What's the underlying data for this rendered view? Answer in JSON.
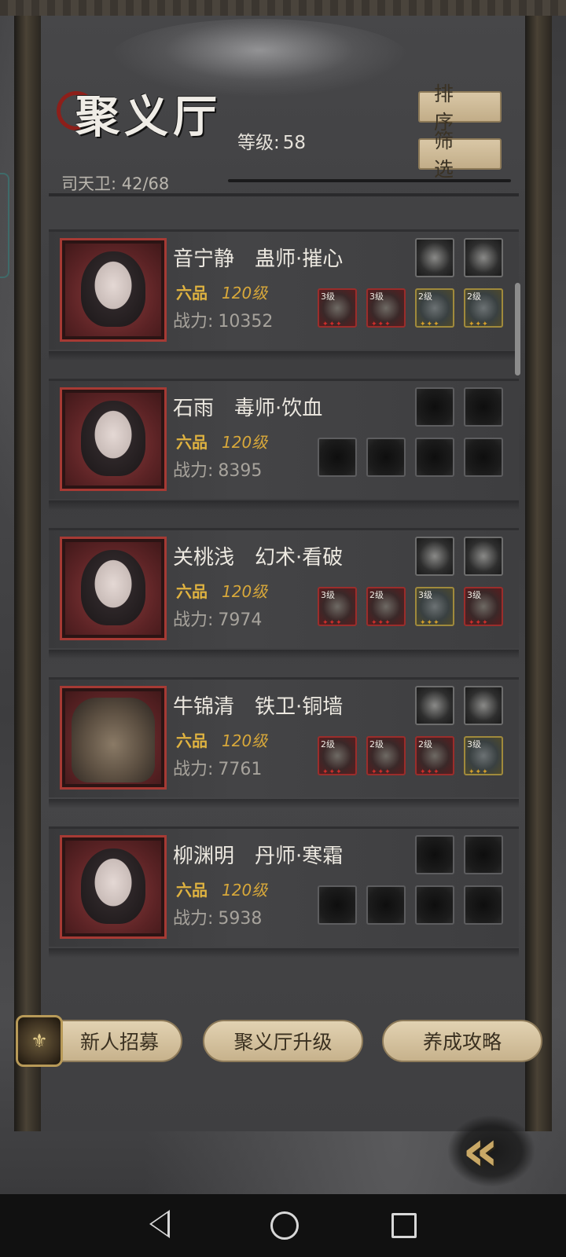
{
  "header": {
    "title": "聚义厅",
    "level_label": "等级:",
    "level_value": "58",
    "guard_count": "司天卫: 42/68",
    "sort_label": "排序",
    "filter_label": "筛选"
  },
  "heroes": [
    {
      "name": "音宁静　蛊师·摧心",
      "rank": "六品",
      "level": "120级",
      "power_label": "战力:",
      "power": "10352",
      "slots_top": [
        "",
        ""
      ],
      "slots_bottom": [
        "3级",
        "3级",
        "2级",
        "2级"
      ]
    },
    {
      "name": "石雨　毒师·饮血",
      "rank": "六品",
      "level": "120级",
      "power_label": "战力:",
      "power": "8395",
      "slots_top": [
        "",
        ""
      ],
      "slots_bottom": [
        "",
        "",
        "",
        ""
      ]
    },
    {
      "name": "关桃浅　幻术·看破",
      "rank": "六品",
      "level": "120级",
      "power_label": "战力:",
      "power": "7974",
      "slots_top": [
        "",
        ""
      ],
      "slots_bottom": [
        "3级",
        "2级",
        "3级",
        "3级"
      ]
    },
    {
      "name": "牛锦清　铁卫·铜墙",
      "rank": "六品",
      "level": "120级",
      "power_label": "战力:",
      "power": "7761",
      "slots_top": [
        "",
        ""
      ],
      "slots_bottom": [
        "2级",
        "2级",
        "2级",
        "3级"
      ]
    },
    {
      "name": "柳渊明　丹师·寒霜",
      "rank": "六品",
      "level": "120级",
      "power_label": "战力:",
      "power": "5938",
      "slots_top": [
        "",
        ""
      ],
      "slots_bottom": [
        "",
        "",
        "",
        ""
      ]
    }
  ],
  "bottom": {
    "recruit_label": "新人招募",
    "upgrade_label": "聚义厅升级",
    "guide_label": "养成攻略",
    "back_glyph": "«"
  },
  "icons": {
    "back_nav": "triangle-back-icon",
    "home_nav": "circle-home-icon",
    "recent_nav": "square-recent-icon"
  }
}
